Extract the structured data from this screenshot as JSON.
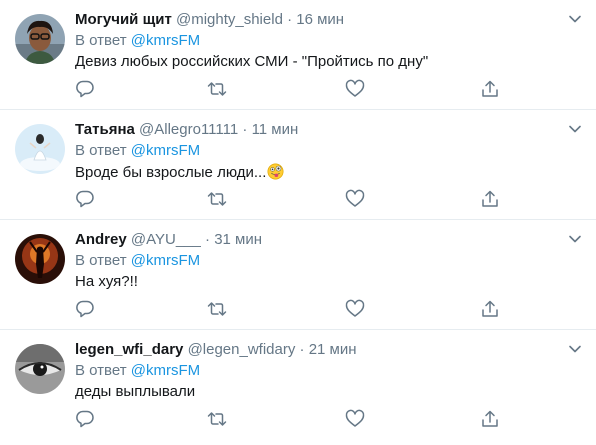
{
  "tweets": [
    {
      "name": "Могучий щит",
      "handle": "@mighty_shield",
      "time": "16 мин",
      "reply_prefix": "В ответ ",
      "reply_to": "@kmrsFM",
      "text": "Девиз любых российских СМИ - \"Пройтись по дну\"",
      "avatar": "face-avatar"
    },
    {
      "name": "Татьяна",
      "handle": "@Allegro11111",
      "time": "11 мин",
      "reply_prefix": "В ответ ",
      "reply_to": "@kmrsFM",
      "text": "Вроде бы взрослые люди...",
      "avatar": "sky-avatar"
    },
    {
      "name": "Andrey",
      "handle": "@AYU___",
      "time": "31 мин",
      "reply_prefix": "В ответ ",
      "reply_to": "@kmrsFM",
      "text": "На хуя?!!",
      "avatar": "fire-avatar"
    },
    {
      "name": "legen_wfi_dary",
      "handle": "@legen_wfidary",
      "time": "21 мин",
      "reply_prefix": "В ответ ",
      "reply_to": "@kmrsFM",
      "text": "деды выплывали",
      "avatar": "eye-avatar"
    }
  ],
  "separator": "·",
  "colors": {
    "link": "#1b95e0",
    "muted": "#657786",
    "text": "#14171a",
    "divider": "#e6ecf0"
  }
}
